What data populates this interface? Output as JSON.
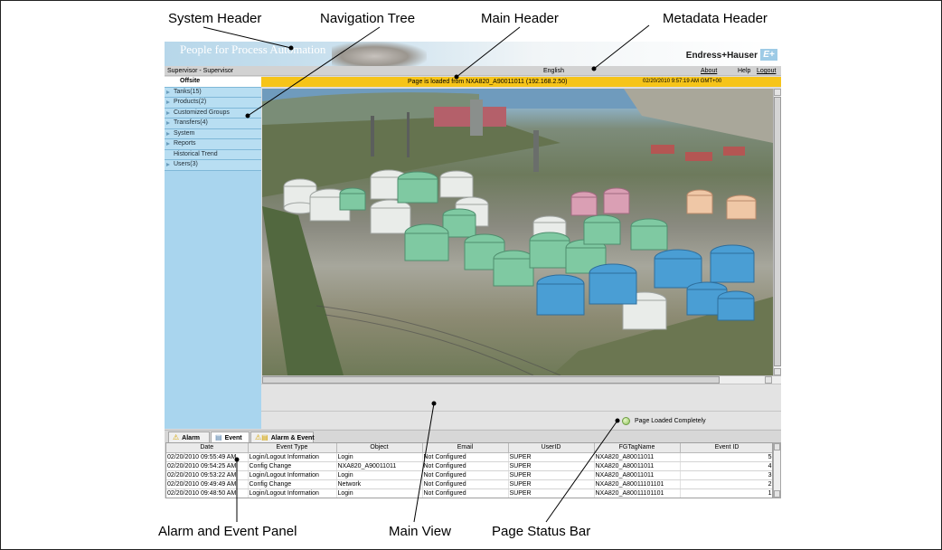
{
  "callouts": {
    "system_header": "System Header",
    "navigation_tree": "Navigation Tree",
    "main_header": "Main Header",
    "metadata_header": "Metadata Header",
    "alarm_event_panel": "Alarm and Event Panel",
    "main_view": "Main View",
    "page_status_bar": "Page Status Bar"
  },
  "system_header": {
    "title": "People for Process Automation",
    "brand": "Endress+Hauser",
    "brand_logo_text": "E+"
  },
  "metadata_header": {
    "user": "Supervisor - Supervisor",
    "language": "English",
    "about": "About",
    "help": "Help",
    "logout": "Logout"
  },
  "navigation": {
    "items": [
      {
        "label": "Offsite"
      },
      {
        "label": "Tanks(15)"
      },
      {
        "label": "Products(2)"
      },
      {
        "label": "Customized Groups"
      },
      {
        "label": "Transfers(4)"
      },
      {
        "label": "System"
      },
      {
        "label": "Reports"
      },
      {
        "label": "Historical Trend"
      },
      {
        "label": "Users(3)"
      }
    ]
  },
  "main_header": {
    "message": "Page is loaded from NXA820_A90011011 (192.168.2.50)",
    "timestamp": "02/20/2010   9:57:19 AM   GMT+00"
  },
  "status_bar": {
    "text": "Page Loaded Completely"
  },
  "panel": {
    "tabs": [
      {
        "label": "Alarm",
        "icon": "warning-icon"
      },
      {
        "label": "Event",
        "icon": "document-icon"
      },
      {
        "label": "Alarm & Event",
        "icon": "warning-document-icon"
      }
    ],
    "columns": [
      "Date",
      "Event Type",
      "Object",
      "Email",
      "UserID",
      "FGTagName",
      "Event ID"
    ],
    "rows": [
      [
        "02/20/2010 09:55:49 AM",
        "Login/Logout Information",
        "Login",
        "Not Configured",
        "SUPER",
        "NXA820_A80011011",
        "5"
      ],
      [
        "02/20/2010 09:54:25 AM",
        "Config Change",
        "NXA820_A90011011",
        "Not Configured",
        "SUPER",
        "NXA820_A80011011",
        "4"
      ],
      [
        "02/20/2010 09:53:22 AM",
        "Login/Logout Information",
        "Login",
        "Not Configured",
        "SUPER",
        "NXA820_A80011011",
        "3"
      ],
      [
        "02/20/2010 09:49:49 AM",
        "Config Change",
        "Network",
        "Not Configured",
        "SUPER",
        "NXA820_A80011101101",
        "2"
      ],
      [
        "02/20/2010 09:48:50 AM",
        "Login/Logout Information",
        "Login",
        "Not Configured",
        "SUPER",
        "NXA820_A80011101101",
        "1"
      ]
    ]
  },
  "colors": {
    "main_header_bg": "#f6c419",
    "nav_bg": "#a9d5ee",
    "metadata_bg": "#d2d2d2"
  }
}
